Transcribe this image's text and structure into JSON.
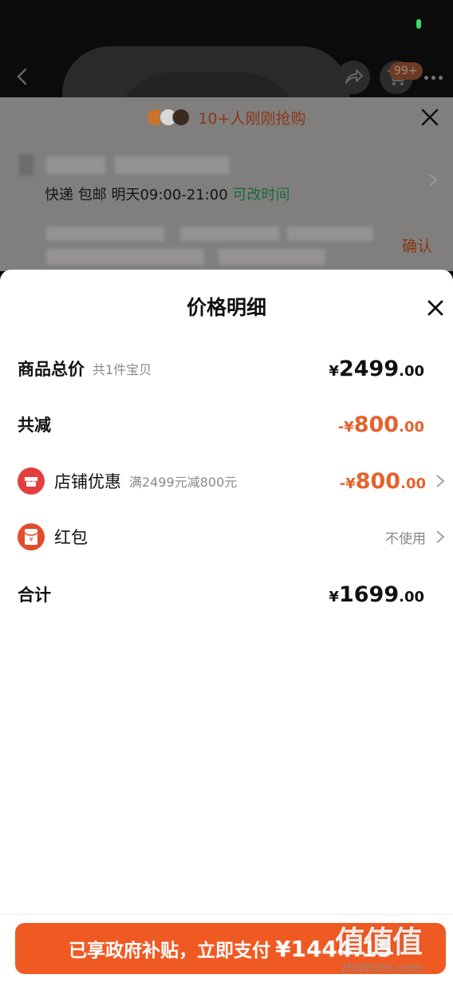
{
  "header": {
    "cart_badge": "99+"
  },
  "panel": {
    "buyers_text": "10+人刚刚抢购",
    "delivery_method": "快递 包邮",
    "delivery_time": "明天09:00-21:00",
    "change_time": "可改时间",
    "confirm_label": "确认"
  },
  "sheet": {
    "title": "价格明细",
    "rows": [
      {
        "label": "商品总价",
        "sub": "共1件宝贝",
        "currency": "¥",
        "int": "2499",
        "dec": ".00"
      },
      {
        "label": "共减",
        "currency": "-¥",
        "int": "800",
        "dec": ".00"
      },
      {
        "label": "店铺优惠",
        "sub": "满2499元减800元",
        "currency": "-¥",
        "int": "800",
        "dec": ".00"
      },
      {
        "label": "红包",
        "value": "不使用"
      },
      {
        "label": "合计",
        "currency": "¥",
        "int": "1699",
        "dec": ".00"
      }
    ]
  },
  "bottom": {
    "pay_label": "已享政府补贴，立即支付",
    "pay_amount": "¥1444.15"
  },
  "watermark": {
    "text": "值值值",
    "url": "zhizhizhi.com"
  },
  "colors": {
    "accent": "#ef5a23",
    "discount": "#e5622c"
  }
}
